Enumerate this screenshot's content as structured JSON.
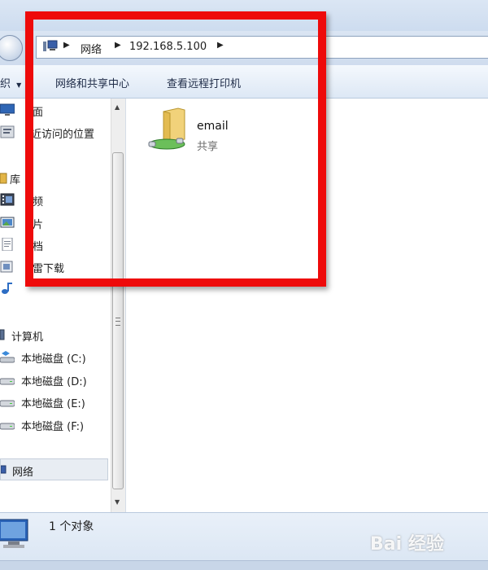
{
  "address_bar": {
    "crumbs": [
      "网络",
      "192.168.5.100"
    ]
  },
  "toolbar": {
    "organize_label": "织",
    "network_center_label": "网络和共享中心",
    "remote_printers_label": "查看远程打印机"
  },
  "nav": {
    "items": [
      {
        "label": "面",
        "icon": "desktop-icon"
      },
      {
        "label": "近访问的位置",
        "icon": "recent-places-icon"
      },
      {
        "label": "库",
        "icon": "library-icon"
      },
      {
        "label": "频",
        "icon": "video-icon"
      },
      {
        "label": "片",
        "icon": "pictures-icon"
      },
      {
        "label": "档",
        "icon": "documents-icon"
      },
      {
        "label": "雷下载",
        "icon": "thunder-download-icon"
      },
      {
        "label": "",
        "icon": "music-icon"
      },
      {
        "label": "计算机",
        "icon": "computer-icon"
      },
      {
        "label": "本地磁盘 (C:)",
        "icon": "drive-c-icon"
      },
      {
        "label": "本地磁盘 (D:)",
        "icon": "drive-icon"
      },
      {
        "label": "本地磁盘 (E:)",
        "icon": "drive-icon"
      },
      {
        "label": "本地磁盘 (F:)",
        "icon": "drive-icon"
      },
      {
        "label": "网络",
        "icon": "network-icon"
      }
    ]
  },
  "content": {
    "share": {
      "name": "email",
      "type": "共享"
    }
  },
  "status": {
    "text": "1 个对象"
  },
  "watermark": {
    "text": "Bai 经验"
  },
  "colors": {
    "highlight": "#ee0a0a"
  }
}
